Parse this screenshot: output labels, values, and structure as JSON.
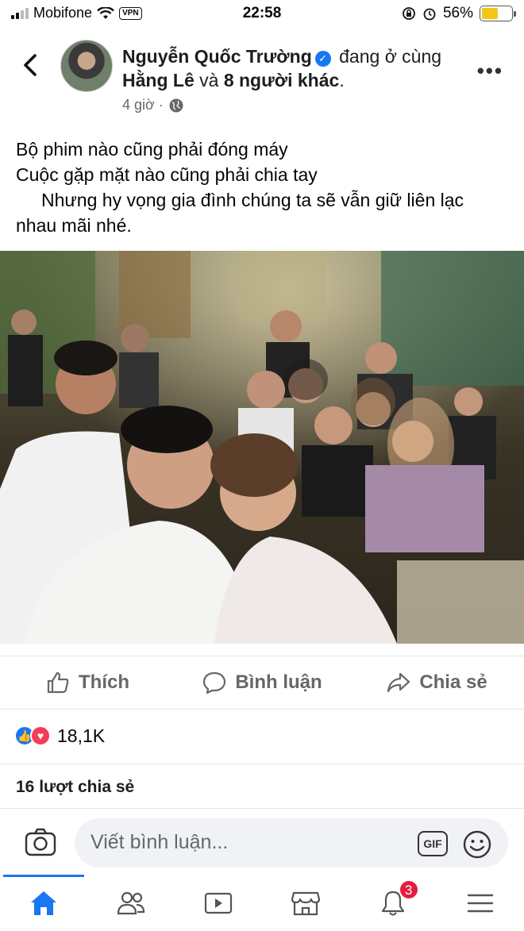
{
  "status_bar": {
    "carrier": "Mobifone",
    "vpn_label": "VPN",
    "time": "22:58",
    "battery": "56%",
    "battery_level": 0.56,
    "icons": [
      "signal-icon",
      "wifi-icon",
      "rotation-lock-icon",
      "alarm-icon",
      "battery-icon"
    ]
  },
  "post": {
    "author": "Nguyễn Quốc Trường",
    "tag_prefix": "đang ở",
    "tag_with": "cùng",
    "tag_person": "Hằng Lê",
    "tag_and": "và",
    "tag_others": "8 người khác",
    "tag_end": ".",
    "time": "4 giờ ·",
    "text_lines": [
      "Bộ phim nào cũng phải đóng máy",
      "Cuộc gặp mặt nào cũng phải chia tay",
      "Nhưng hy vọng gia đình chúng ta sẽ vẫn giữ liên lạc nhau mãi nhé."
    ]
  },
  "actions": {
    "like": "Thích",
    "comment": "Bình luận",
    "share": "Chia sẻ"
  },
  "stats": {
    "reactions": "18,1K",
    "shares": "16 lượt chia sẻ"
  },
  "comment_box": {
    "placeholder": "Viết bình luận...",
    "gif_label": "GIF"
  },
  "nav": {
    "items": [
      "home-icon",
      "friends-icon",
      "watch-icon",
      "marketplace-icon",
      "notifications-icon",
      "menu-icon"
    ],
    "notification_count": "3"
  },
  "colors": {
    "accent": "#1877f2",
    "badge": "#e41e3f",
    "secondary_text": "#65676b"
  }
}
